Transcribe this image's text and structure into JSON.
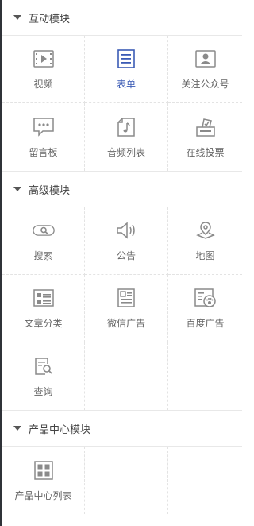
{
  "sections": [
    {
      "title": "互动模块",
      "items": [
        {
          "label": "视频",
          "icon": "video-icon"
        },
        {
          "label": "表单",
          "icon": "form-icon",
          "active": true
        },
        {
          "label": "关注公众号",
          "icon": "follow-account-icon"
        },
        {
          "label": "留言板",
          "icon": "message-board-icon"
        },
        {
          "label": "音频列表",
          "icon": "audio-list-icon"
        },
        {
          "label": "在线投票",
          "icon": "vote-icon"
        }
      ]
    },
    {
      "title": "高级模块",
      "items": [
        {
          "label": "搜索",
          "icon": "search-icon"
        },
        {
          "label": "公告",
          "icon": "announcement-icon"
        },
        {
          "label": "地图",
          "icon": "map-icon"
        },
        {
          "label": "文章分类",
          "icon": "article-category-icon"
        },
        {
          "label": "微信广告",
          "icon": "wechat-ad-icon"
        },
        {
          "label": "百度广告",
          "icon": "baidu-ad-icon"
        },
        {
          "label": "查询",
          "icon": "query-icon"
        }
      ]
    },
    {
      "title": "产品中心模块",
      "items": [
        {
          "label": "产品中心列表",
          "icon": "product-list-icon"
        }
      ]
    }
  ],
  "colors": {
    "icon": "#8a8a8a",
    "active": "#3b5bb5",
    "border": "#e3e3e3",
    "rule": "#2f3238"
  }
}
